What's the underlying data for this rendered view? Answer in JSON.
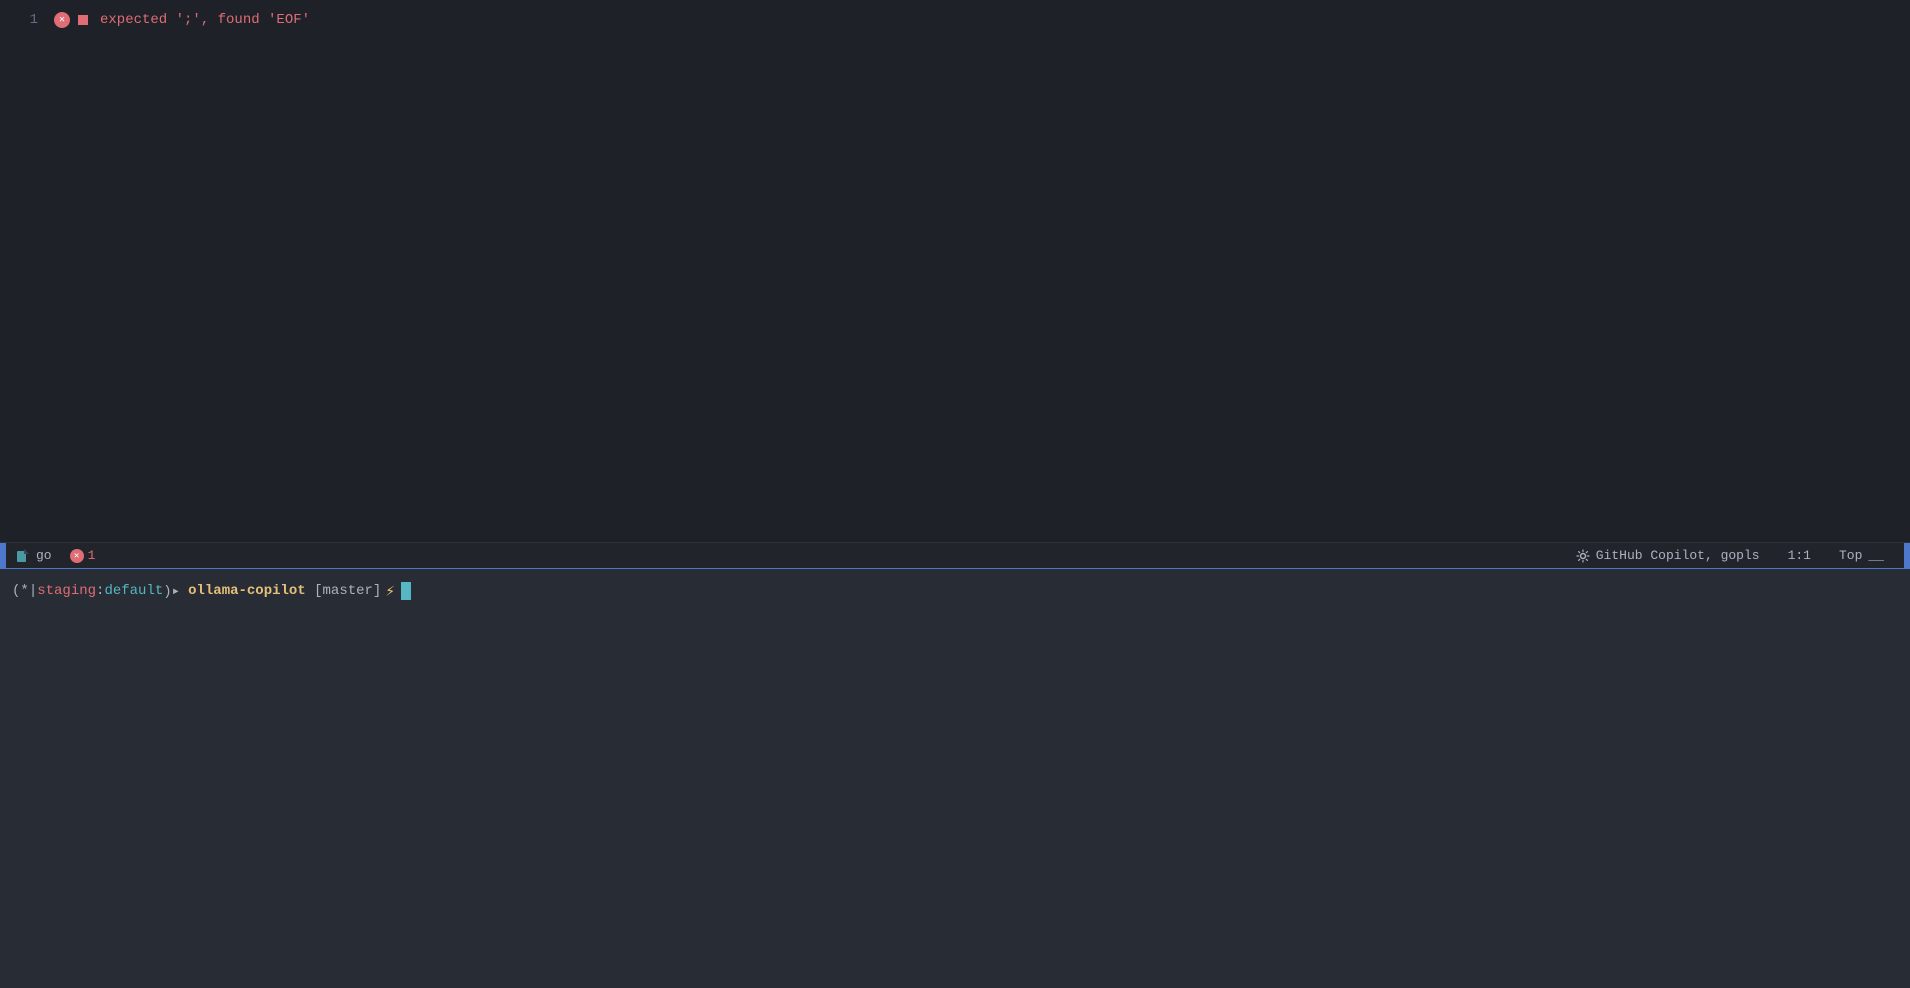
{
  "editor": {
    "background": "#1e2127",
    "line1": {
      "number": "1",
      "error_message": "expected ';', found 'EOF'"
    }
  },
  "status_bar": {
    "file_type": "go",
    "error_count": "1",
    "copilot_label": "GitHub Copilot, gopls",
    "position": "1:1",
    "scroll_position": "Top",
    "gear_label": "settings"
  },
  "terminal": {
    "prefix": "(*|",
    "staging": "staging",
    "colon": ":",
    "namespace": "default",
    "suffix": ")▸",
    "project": "ollama-copilot",
    "branch": "[master]",
    "lightning": "⚡"
  }
}
